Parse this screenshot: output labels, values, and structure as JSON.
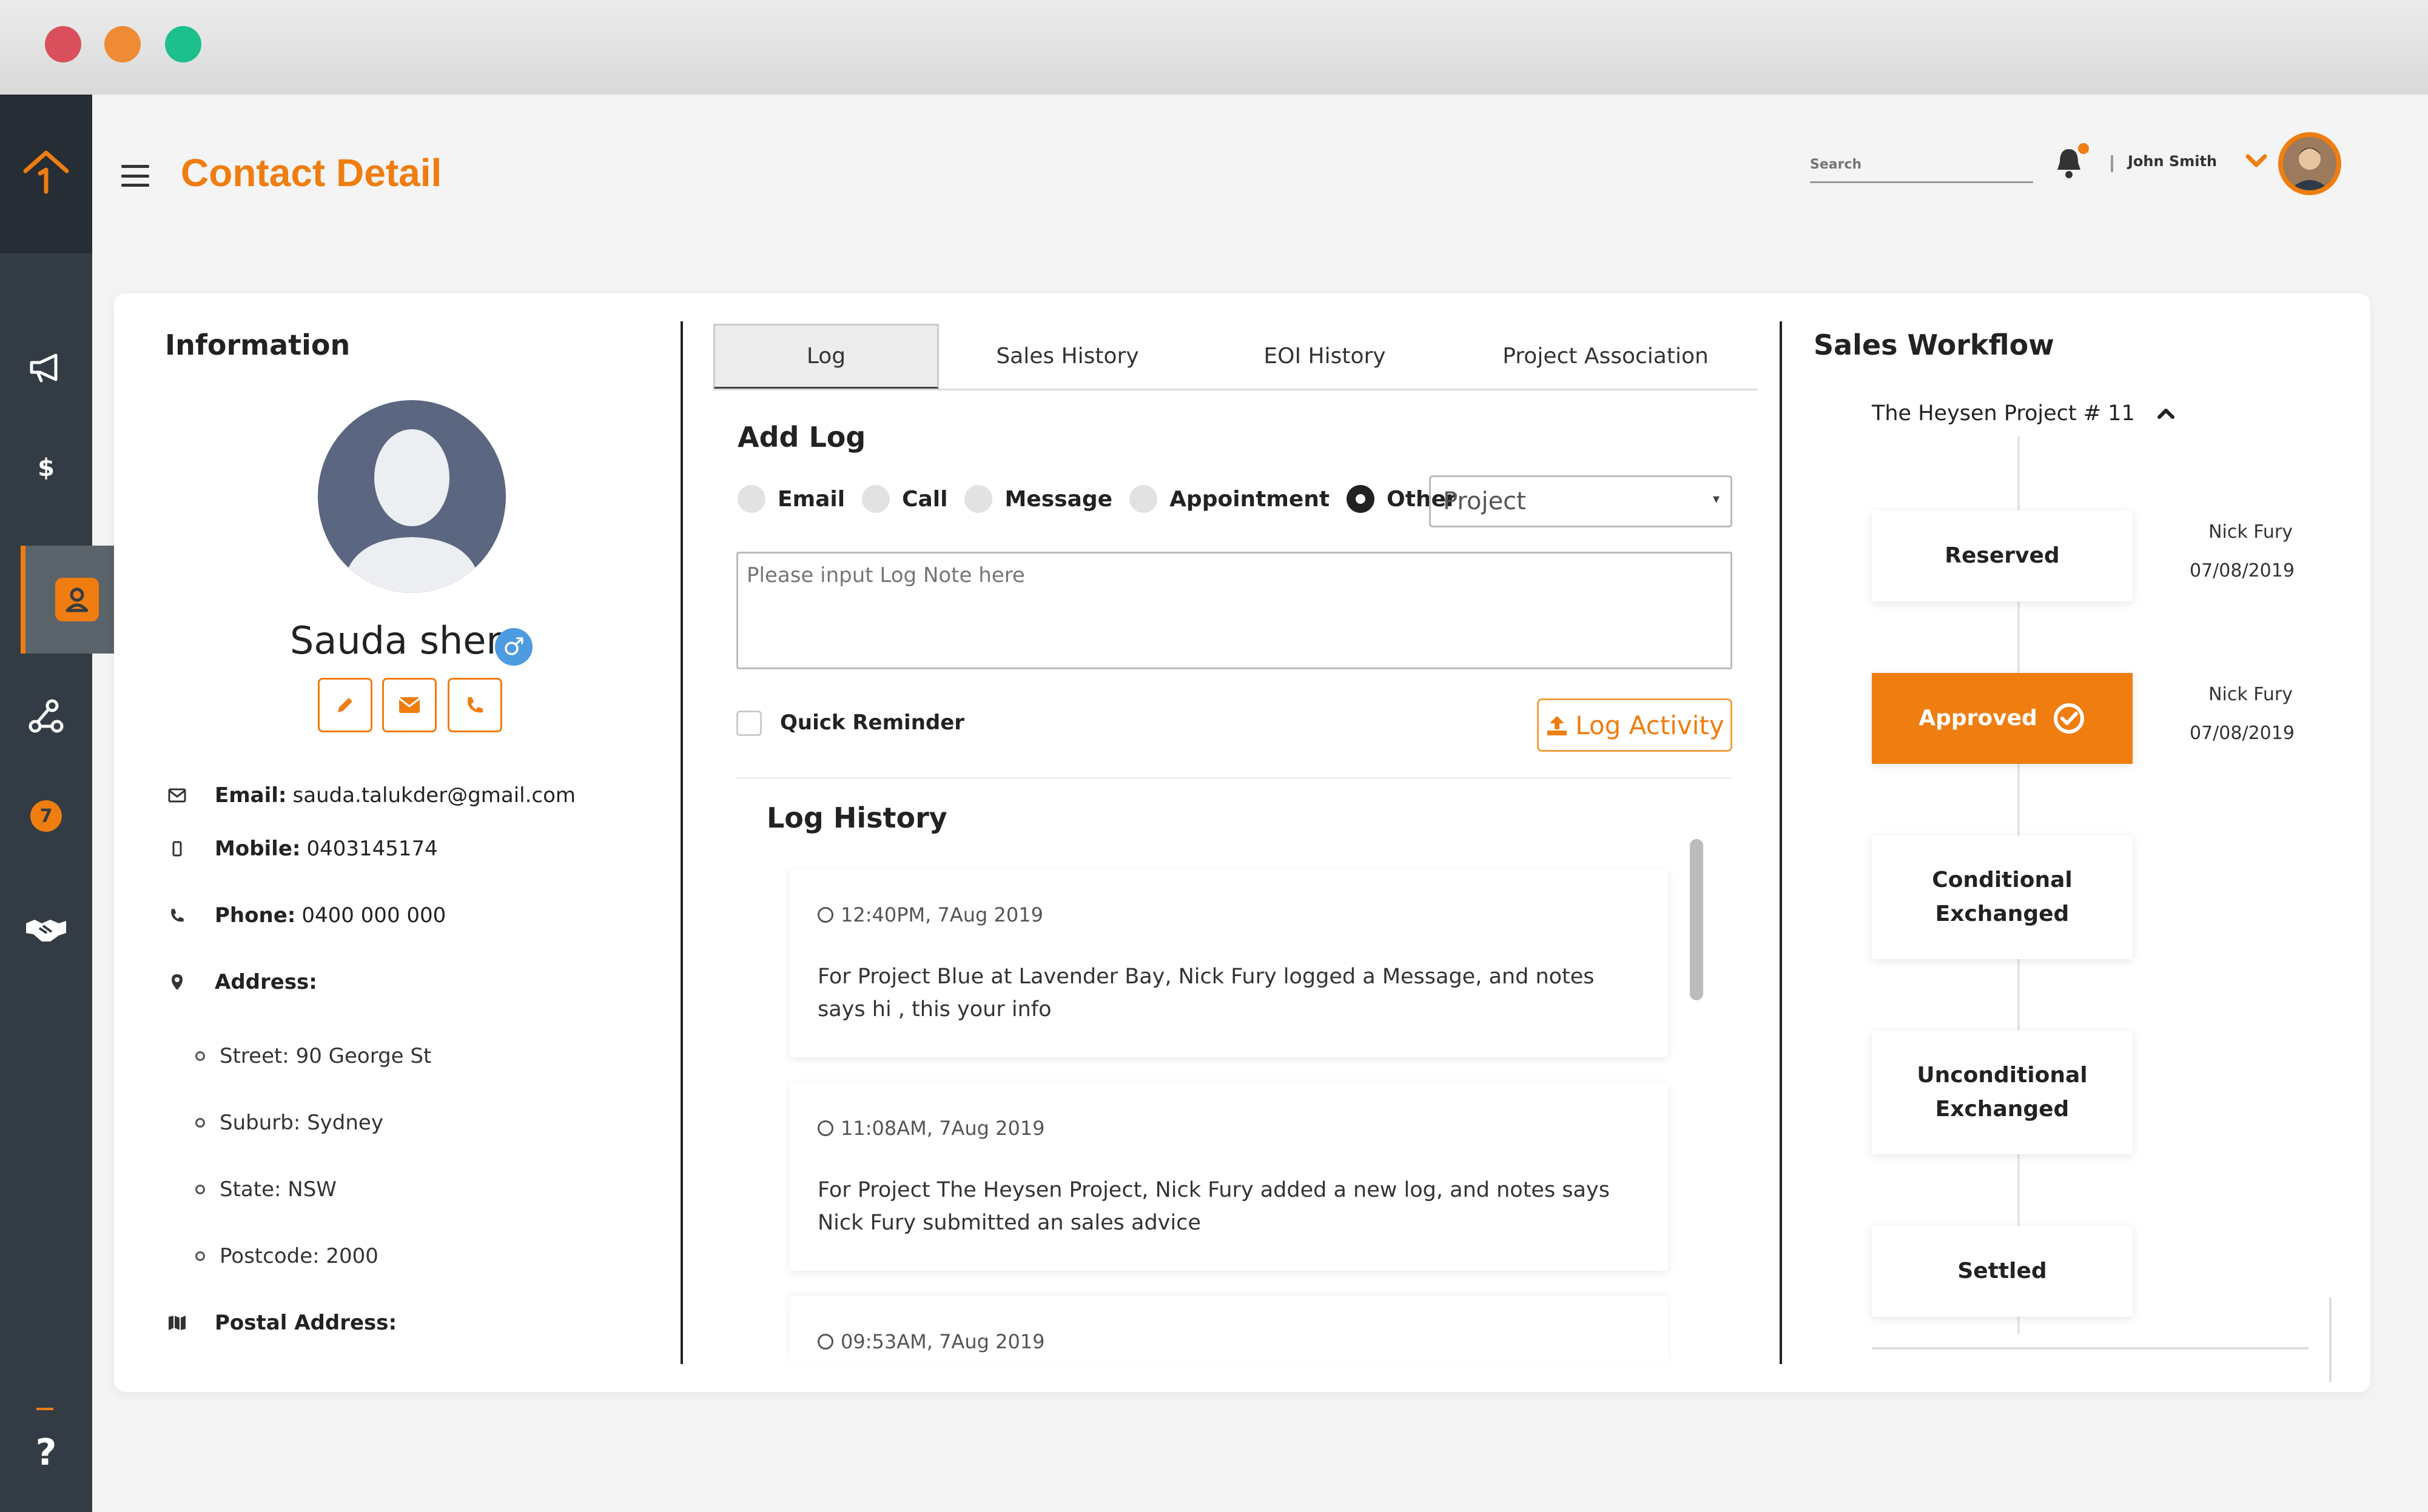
{
  "header": {
    "title": "Contact Detail",
    "search_placeholder": "Search",
    "user_name": "John Smith"
  },
  "sidebar": {
    "badge_count": "7",
    "dollar_glyph": "$",
    "help_glyph": "?"
  },
  "info": {
    "section_title": "Information",
    "name": "Sauda shen",
    "gender_glyph": "♂",
    "email_label": "Email:",
    "email": "sauda.talukder@gmail.com",
    "mobile_label": "Mobile:",
    "mobile": "0403145174",
    "phone_label": "Phone:",
    "phone": "0400 000 000",
    "address_label": "Address:",
    "address": [
      "Street: 90 George St",
      "Suburb: Sydney",
      "State: NSW",
      "Postcode: 2000"
    ],
    "postal_label": "Postal Address:"
  },
  "tabs": [
    "Log",
    "Sales History",
    "EOI History",
    "Project Association"
  ],
  "add_log": {
    "title": "Add Log",
    "options": [
      "Email",
      "Call",
      "Message",
      "Appointment",
      "Other"
    ],
    "selected": "Other",
    "select_value": "Project",
    "note_placeholder": "Please input Log Note here",
    "quick_reminder": "Quick Reminder",
    "log_button": "Log Activity"
  },
  "log_history": {
    "title": "Log History",
    "entries": [
      {
        "time": "12:40PM, 7Aug 2019",
        "text": "For Project Blue at Lavender Bay, Nick Fury logged a Message, and notes says hi , this your info"
      },
      {
        "time": "11:08AM, 7Aug 2019",
        "text": "For Project The Heysen Project, Nick Fury added a new log, and notes says Nick Fury submitted an sales advice"
      },
      {
        "time": "09:53AM, 7Aug 2019",
        "text": ""
      }
    ]
  },
  "workflow": {
    "title": "Sales Workflow",
    "project": "The Heysen Project # 11",
    "steps": [
      {
        "label": "Reserved",
        "by": "Nick Fury",
        "date": "07/08/2019"
      },
      {
        "label": "Approved",
        "by": "Nick Fury",
        "date": "07/08/2019"
      },
      {
        "label": "Conditional Exchanged"
      },
      {
        "label": "Unconditional Exchanged"
      },
      {
        "label": "Settled"
      }
    ]
  },
  "colors": {
    "accent": "#ef7d10",
    "sidebar": "#333b44"
  }
}
